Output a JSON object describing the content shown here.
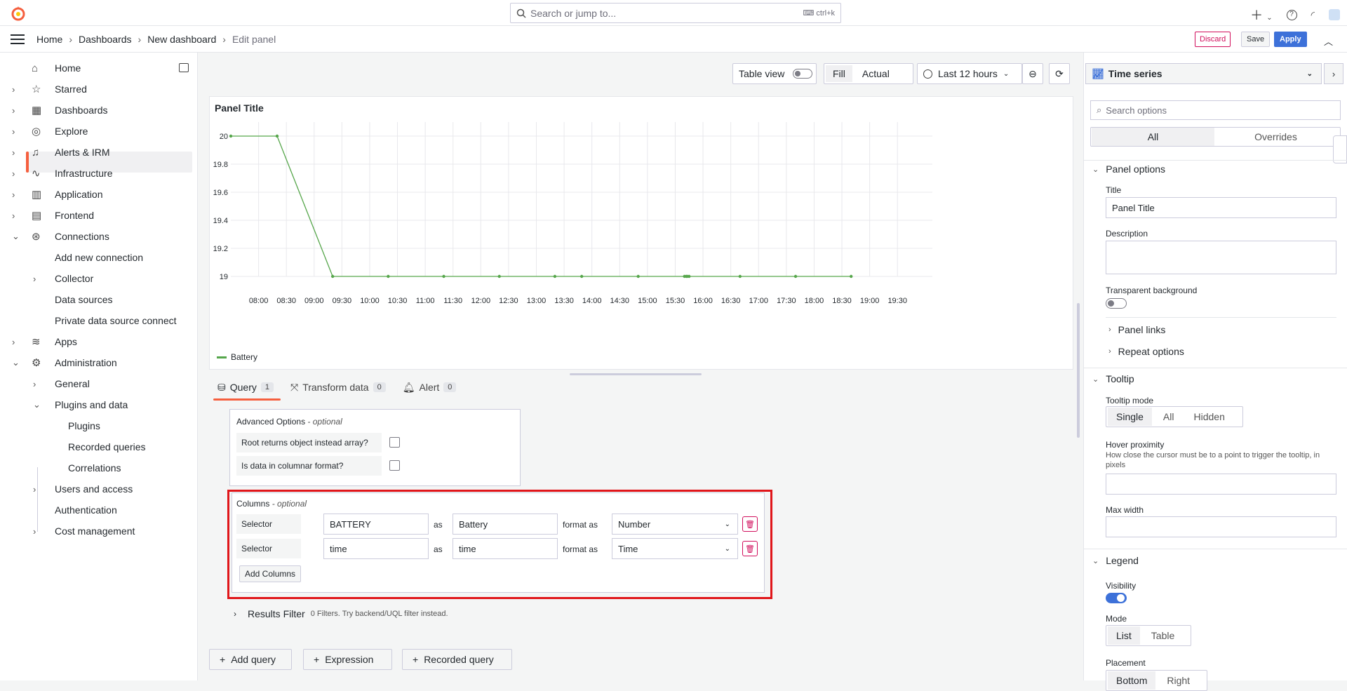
{
  "topbar": {
    "search_placeholder": "Search or jump to...",
    "shortcut": "ctrl+k"
  },
  "breadcrumb": [
    "Home",
    "Dashboards",
    "New dashboard",
    "Edit panel"
  ],
  "actions": {
    "discard": "Discard",
    "save": "Save",
    "apply": "Apply"
  },
  "sidebar": {
    "items": [
      {
        "label": "Home",
        "icon": "home-icon"
      },
      {
        "label": "Starred",
        "icon": "star-icon"
      },
      {
        "label": "Dashboards",
        "icon": "dashboards-icon"
      },
      {
        "label": "Explore",
        "icon": "compass-icon"
      },
      {
        "label": "Alerts & IRM",
        "icon": "bell-icon"
      },
      {
        "label": "Infrastructure",
        "icon": "heartbeat-icon"
      },
      {
        "label": "Application",
        "icon": "bar-chart-icon"
      },
      {
        "label": "Frontend",
        "icon": "frontend-icon"
      },
      {
        "label": "Connections",
        "icon": "connections-icon"
      },
      {
        "label": "Add new connection"
      },
      {
        "label": "Collector"
      },
      {
        "label": "Data sources"
      },
      {
        "label": "Private data source connect"
      },
      {
        "label": "Apps",
        "icon": "layers-icon"
      },
      {
        "label": "Administration",
        "icon": "cog-icon"
      },
      {
        "label": "General"
      },
      {
        "label": "Plugins and data"
      },
      {
        "label": "Plugins"
      },
      {
        "label": "Recorded queries"
      },
      {
        "label": "Correlations"
      },
      {
        "label": "Users and access"
      },
      {
        "label": "Authentication"
      },
      {
        "label": "Cost management"
      }
    ]
  },
  "toolbar": {
    "table_view": "Table view",
    "fill": "Fill",
    "actual": "Actual",
    "time_range": "Last 12 hours"
  },
  "panel": {
    "title": "Panel Title",
    "legend": "Battery"
  },
  "chart_data": {
    "type": "line",
    "title": "Panel Title",
    "x_ticks": [
      "08:00",
      "08:30",
      "09:00",
      "09:30",
      "10:00",
      "10:30",
      "11:00",
      "11:30",
      "12:00",
      "12:30",
      "13:00",
      "13:30",
      "14:00",
      "14:30",
      "15:00",
      "15:30",
      "16:00",
      "16:30",
      "17:00",
      "17:30",
      "18:00",
      "18:30",
      "19:00",
      "19:30"
    ],
    "y_ticks": [
      "20",
      "19.8",
      "19.6",
      "19.4",
      "19.2",
      "19"
    ],
    "ylim": [
      19,
      20
    ],
    "series": [
      {
        "name": "Battery",
        "color": "#56a64b",
        "x": [
          "07:30",
          "08:20",
          "09:20",
          "10:20",
          "11:20",
          "12:20",
          "13:20",
          "13:49",
          "14:50",
          "15:40",
          "15:42",
          "15:43",
          "15:45",
          "16:40",
          "17:40",
          "18:40"
        ],
        "y": [
          20,
          20,
          19,
          19,
          19,
          19,
          19,
          19,
          19,
          19,
          19,
          19,
          19,
          19,
          19,
          19
        ]
      }
    ]
  },
  "tabs": [
    {
      "label": "Query",
      "count": "1"
    },
    {
      "label": "Transform data",
      "count": "0"
    },
    {
      "label": "Alert",
      "count": "0"
    }
  ],
  "query": {
    "advanced_title": "Advanced Options",
    "optional": "- optional",
    "root_returns": "Root returns object instead array?",
    "columnar": "Is data in columnar format?",
    "columns_title": "Columns",
    "selector": "Selector",
    "as": "as",
    "format_as": "format as",
    "rows": [
      {
        "selector": "BATTERY",
        "alias": "Battery",
        "format": "Number"
      },
      {
        "selector": "time",
        "alias": "time",
        "format": "Time"
      }
    ],
    "add_columns": "Add Columns",
    "results_filter": "Results Filter",
    "results_hint": "0 Filters. Try backend/UQL filter instead."
  },
  "bottom_buttons": {
    "add_query": "Add query",
    "expression": "Expression",
    "recorded_query": "Recorded query"
  },
  "options": {
    "viz": "Time series",
    "search_placeholder": "Search options",
    "all": "All",
    "overrides": "Overrides",
    "panel_options": "Panel options",
    "title_label": "Title",
    "title_value": "Panel Title",
    "description": "Description",
    "transparent": "Transparent background",
    "panel_links": "Panel links",
    "repeat_options": "Repeat options",
    "tooltip": "Tooltip",
    "tooltip_mode": "Tooltip mode",
    "modes": [
      "Single",
      "All",
      "Hidden"
    ],
    "hover_proximity": "Hover proximity",
    "hover_desc": "How close the cursor must be to a point to trigger the tooltip, in pixels",
    "max_width": "Max width",
    "legend": "Legend",
    "visibility": "Visibility",
    "mode": "Mode",
    "legend_modes": [
      "List",
      "Table"
    ],
    "placement": "Placement",
    "placements": [
      "Bottom",
      "Right"
    ]
  },
  "colors": {
    "accent": "#f55f3e",
    "primary": "#3d71d9",
    "danger": "#d10e5c",
    "series": "#56a64b"
  }
}
